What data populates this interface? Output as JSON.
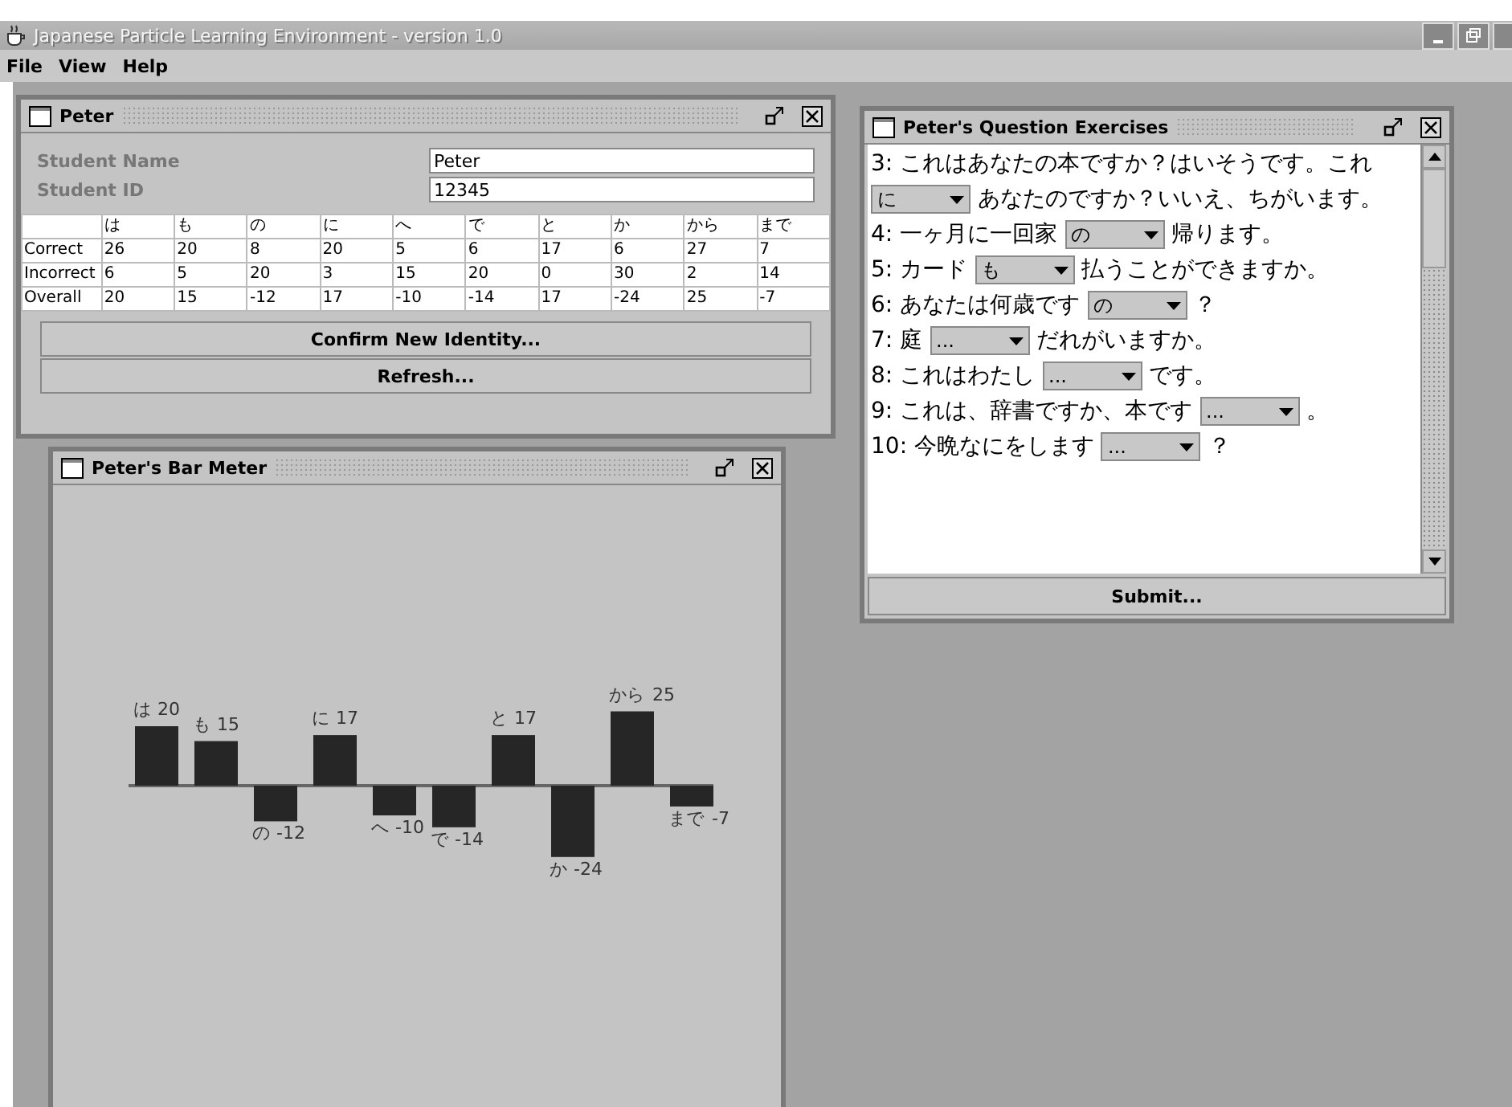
{
  "window": {
    "title": "Japanese Particle Learning Environment - version 1.0"
  },
  "menu": [
    "File",
    "View",
    "Help"
  ],
  "student_frame": {
    "title": "Peter",
    "fields": [
      {
        "label": "Student Name",
        "value": "Peter"
      },
      {
        "label": "Student ID",
        "value": "12345"
      }
    ],
    "table": {
      "columns": [
        "は",
        "も",
        "の",
        "に",
        "へ",
        "で",
        "と",
        "か",
        "から",
        "まで"
      ],
      "rows": [
        {
          "label": "Correct",
          "cells": [
            "26",
            "20",
            "8",
            "20",
            "5",
            "6",
            "17",
            "6",
            "27",
            "7"
          ]
        },
        {
          "label": "Incorrect",
          "cells": [
            "6",
            "5",
            "20",
            "3",
            "15",
            "20",
            "0",
            "30",
            "2",
            "14"
          ]
        },
        {
          "label": "Overall",
          "cells": [
            "20",
            "15",
            "-12",
            "17",
            "-10",
            "-14",
            "17",
            "-24",
            "25",
            "-7"
          ]
        }
      ]
    },
    "buttons": [
      "Confirm New Identity...",
      "Refresh..."
    ]
  },
  "bar_meter": {
    "title": "Peter's Bar Meter",
    "chart_data": {
      "type": "bar",
      "categories": [
        "は",
        "も",
        "の",
        "に",
        "へ",
        "で",
        "と",
        "か",
        "から",
        "まで"
      ],
      "values": [
        20,
        15,
        -12,
        17,
        -10,
        -14,
        17,
        -24,
        25,
        -7
      ],
      "data_labels": true
    }
  },
  "exercises": {
    "title": "Peter's Question Exercises",
    "questions": [
      {
        "number": "3:",
        "before": "これはあなたの本ですか？はいそうです。これ",
        "choice": "に",
        "after": "あなたのですか？いいえ、ちがいます。"
      },
      {
        "number": "4:",
        "before": "一ヶ月に一回家",
        "choice": "の",
        "after": "帰ります。"
      },
      {
        "number": "5:",
        "before": "カード",
        "choice": "も",
        "after": "払うことができますか。"
      },
      {
        "number": "6:",
        "before": "あなたは何歳です",
        "choice": "の",
        "after": "？"
      },
      {
        "number": "7:",
        "before": "庭",
        "choice": "...",
        "after": "だれがいますか。"
      },
      {
        "number": "8:",
        "before": "これはわたし",
        "choice": "...",
        "after": "です。"
      },
      {
        "number": "9:",
        "before": "これは、辞書ですか、本です",
        "choice": "...",
        "after": "。"
      },
      {
        "number": "10:",
        "before": "今晩なにをします",
        "choice": "...",
        "after": "？"
      }
    ],
    "button": "Submit..."
  }
}
